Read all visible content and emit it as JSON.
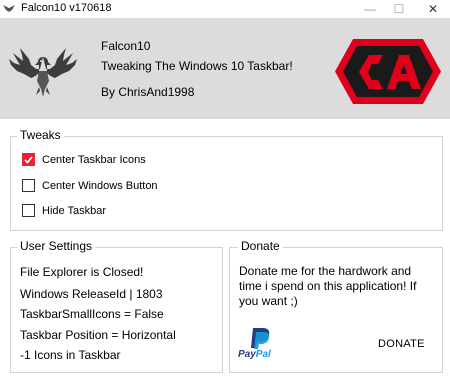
{
  "window": {
    "title": "Falcon10 v170618"
  },
  "window_controls": {
    "minimize": "—",
    "maximize": "☐",
    "close": "✕"
  },
  "header": {
    "app_name": "Falcon10",
    "description": "Tweaking The Windows 10 Taskbar!",
    "author": "By ChrisAnd1998"
  },
  "tweaks": {
    "legend": "Tweaks",
    "options": [
      {
        "label": "Center Taskbar Icons",
        "checked": true
      },
      {
        "label": "Center Windows Button",
        "checked": false
      },
      {
        "label": "Hide Taskbar",
        "checked": false
      }
    ]
  },
  "user_settings": {
    "legend": "User Settings",
    "lines": [
      "File Explorer is Closed!",
      "Windows ReleaseId | 1803",
      "TaskbarSmallIcons = False",
      "Taskbar Position = Horizontal",
      "-1 Icons in Taskbar"
    ]
  },
  "donate": {
    "legend": "Donate",
    "text": "Donate me for the hardwork and time i spend on this application! If you want ;)",
    "paypal_label_pay": "Pay",
    "paypal_label_pal": "Pal",
    "button_label": "DONATE"
  },
  "colors": {
    "accent_red": "#e6233b",
    "ca_logo_red": "#e1001b",
    "paypal_dark_blue": "#253b80",
    "paypal_light_blue": "#179bd7",
    "header_bg": "#dcdcdc"
  },
  "icons": {
    "app_icon": "falcon-icon",
    "logo": "falcon-logo",
    "brand_logo": "ca-logo",
    "paypal": "paypal-icon"
  }
}
